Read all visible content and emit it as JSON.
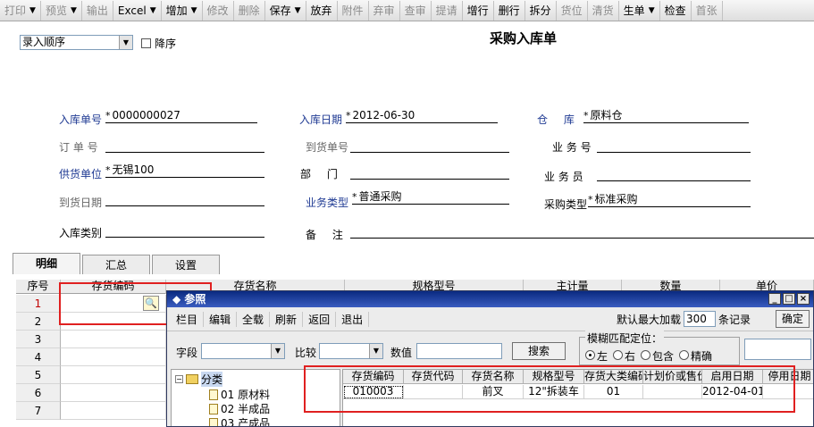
{
  "toolbar": {
    "items": [
      {
        "label": "打印",
        "dropdown": true,
        "disabled": true
      },
      {
        "label": "预览",
        "dropdown": true,
        "disabled": true
      },
      {
        "label": "输出",
        "dropdown": false,
        "disabled": true
      },
      {
        "label": "Excel",
        "dropdown": true,
        "disabled": false
      },
      {
        "label": "增加",
        "dropdown": true,
        "disabled": false
      },
      {
        "label": "修改",
        "dropdown": false,
        "disabled": true
      },
      {
        "label": "删除",
        "dropdown": false,
        "disabled": true
      },
      {
        "label": "保存",
        "dropdown": true,
        "disabled": false
      },
      {
        "label": "放弃",
        "dropdown": false,
        "disabled": false
      },
      {
        "label": "附件",
        "dropdown": false,
        "disabled": true
      },
      {
        "label": "弃审",
        "dropdown": false,
        "disabled": true
      },
      {
        "label": "查审",
        "dropdown": false,
        "disabled": true
      },
      {
        "label": "提请",
        "dropdown": false,
        "disabled": true
      },
      {
        "label": "增行",
        "dropdown": false,
        "disabled": false
      },
      {
        "label": "删行",
        "dropdown": false,
        "disabled": false
      },
      {
        "label": "拆分",
        "dropdown": false,
        "disabled": false
      },
      {
        "label": "货位",
        "dropdown": false,
        "disabled": true
      },
      {
        "label": "清货",
        "dropdown": false,
        "disabled": true
      },
      {
        "label": "生单",
        "dropdown": true,
        "disabled": false
      },
      {
        "label": "检查",
        "dropdown": false,
        "disabled": false
      },
      {
        "label": "首张",
        "dropdown": false,
        "disabled": true
      }
    ]
  },
  "header": {
    "order_select": "录入顺序",
    "descending_label": "降序",
    "title": "采购入库单"
  },
  "fields": {
    "inbound_no_label": "入库单号",
    "inbound_no_value": "0000000027",
    "inbound_date_label": "入库日期",
    "inbound_date_value": "2012-06-30",
    "warehouse_label": "仓 库",
    "warehouse_value": "原料仓",
    "order_no_label": "订 单 号",
    "arrival_no_label": "到货单号",
    "biz_no_label": "业 务 号",
    "supplier_label": "供货单位",
    "supplier_value": "无锡100",
    "dept_label": "部 门",
    "salesman_label": "业 务 员",
    "arrival_date_label": "到货日期",
    "biz_type_label": "业务类型",
    "biz_type_value": "普通采购",
    "purchase_type_label": "采购类型",
    "purchase_type_value": "标准采购",
    "inbound_category_label": "入库类别",
    "remark_label": "备 注"
  },
  "tabs": [
    "明细",
    "汇总",
    "设置"
  ],
  "grid": {
    "headers": [
      "序号",
      "存货编码",
      "存货名称",
      "规格型号",
      "主计量",
      "数量",
      "单价"
    ],
    "rows": [
      "1",
      "2",
      "3",
      "4",
      "5",
      "6",
      "7"
    ]
  },
  "dialog": {
    "title": "参照",
    "toolbar": [
      "栏目",
      "编辑",
      "全载",
      "刷新",
      "返回",
      "退出"
    ],
    "max_load_label": "默认最大加载",
    "max_load_value": "300",
    "max_load_unit": "条记录",
    "ok_label": "确定",
    "field_label": "字段",
    "compare_label": "比较",
    "value_label": "数值",
    "search_label": "搜索",
    "fuzzy_label": "模糊匹配定位：",
    "fuzzy_options": [
      "左",
      "右",
      "包含",
      "精确"
    ],
    "tree": {
      "root": "分类",
      "children": [
        "01 原材料",
        "02 半成品",
        "03 产成品"
      ]
    },
    "result_headers": [
      "存货编码",
      "存货代码",
      "存货名称",
      "规格型号",
      "存货大类编码",
      "计划价或售价",
      "启用日期",
      "停用日期"
    ],
    "result_row": [
      "010003",
      "",
      "前叉",
      "12\"拆装车",
      "01",
      "",
      "2012-04-01",
      ""
    ]
  },
  "colors": {
    "highlight_box": "#e02020",
    "dialog_title": "#0a2a80",
    "label_blue": "#1f3a93"
  }
}
